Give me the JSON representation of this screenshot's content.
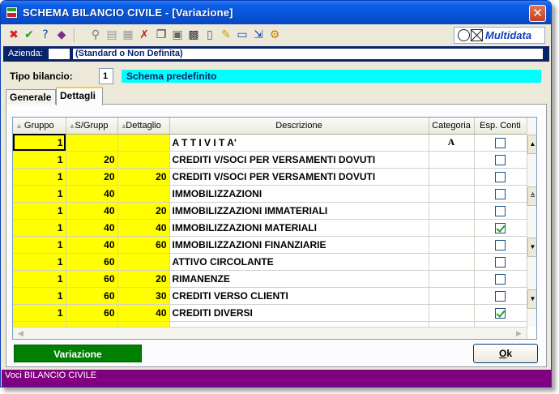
{
  "window": {
    "title": "SCHEMA BILANCIO CIVILE - [Variazione]",
    "close_label": "✕"
  },
  "toolbar": {
    "buttons": [
      {
        "icon": "close-icon",
        "glyph": "✖",
        "color": "#d42020"
      },
      {
        "icon": "check-icon",
        "glyph": "✔",
        "color": "#2a9d2a"
      },
      {
        "icon": "help-icon",
        "glyph": "?",
        "color": "#1340b8"
      },
      {
        "icon": "book-icon",
        "glyph": "◆",
        "color": "#7a2f8a"
      },
      {
        "icon": "binoculars-icon",
        "glyph": "⚲",
        "color": "#777777"
      },
      {
        "icon": "print-preview-icon",
        "glyph": "▤",
        "color": "#999999"
      },
      {
        "icon": "print-icon",
        "glyph": "▦",
        "color": "#999999"
      },
      {
        "icon": "delete-icon",
        "glyph": "✗",
        "color": "#c02020"
      },
      {
        "icon": "copy-icon",
        "glyph": "❐",
        "color": "#333333"
      },
      {
        "icon": "paste-icon",
        "glyph": "▣",
        "color": "#666666"
      },
      {
        "icon": "calculator-icon",
        "glyph": "▩",
        "color": "#333333"
      },
      {
        "icon": "new-document-icon",
        "glyph": "▯",
        "color": "#555555"
      },
      {
        "icon": "edit-document-icon",
        "glyph": "✎",
        "color": "#c8a000"
      },
      {
        "icon": "window-icon",
        "glyph": "▭",
        "color": "#1340b8"
      },
      {
        "icon": "export-icon",
        "glyph": "⇲",
        "color": "#1340b8"
      },
      {
        "icon": "settings-icon",
        "glyph": "⚙",
        "color": "#c88000"
      }
    ],
    "logo_text": "Multidata"
  },
  "azienda": {
    "label": "Azienda:",
    "code": "",
    "name": "(Standard o Non Definita)"
  },
  "tipo_bilancio": {
    "label": "Tipo bilancio:",
    "code": "1",
    "description": "Schema predefinito"
  },
  "tabs": [
    {
      "label": "Generale",
      "active": false
    },
    {
      "label": "Dettagli",
      "active": true
    }
  ],
  "grid": {
    "columns": [
      "Gruppo",
      "S/Grupp",
      "Dettaglio",
      "Descrizione",
      "Categoria",
      "Esp. Conti"
    ],
    "rows": [
      {
        "gruppo": "1",
        "sgrupp": "",
        "dettaglio": "",
        "descrizione": "A T T I V I T A'",
        "categoria": "A",
        "esp_conti": false
      },
      {
        "gruppo": "1",
        "sgrupp": "20",
        "dettaglio": "",
        "descrizione": "CREDITI V/SOCI PER VERSAMENTI DOVUTI",
        "categoria": "",
        "esp_conti": false
      },
      {
        "gruppo": "1",
        "sgrupp": "20",
        "dettaglio": "20",
        "descrizione": "CREDITI V/SOCI PER VERSAMENTI DOVUTI",
        "categoria": "",
        "esp_conti": false
      },
      {
        "gruppo": "1",
        "sgrupp": "40",
        "dettaglio": "",
        "descrizione": "IMMOBILIZZAZIONI",
        "categoria": "",
        "esp_conti": false
      },
      {
        "gruppo": "1",
        "sgrupp": "40",
        "dettaglio": "20",
        "descrizione": "IMMOBILIZZAZIONI IMMATERIALI",
        "categoria": "",
        "esp_conti": false
      },
      {
        "gruppo": "1",
        "sgrupp": "40",
        "dettaglio": "40",
        "descrizione": "IMMOBILIZZAZIONI MATERIALI",
        "categoria": "",
        "esp_conti": true
      },
      {
        "gruppo": "1",
        "sgrupp": "40",
        "dettaglio": "60",
        "descrizione": "IMMOBILIZZAZIONI FINANZIARIE",
        "categoria": "",
        "esp_conti": false
      },
      {
        "gruppo": "1",
        "sgrupp": "60",
        "dettaglio": "",
        "descrizione": "ATTIVO CIRCOLANTE",
        "categoria": "",
        "esp_conti": false
      },
      {
        "gruppo": "1",
        "sgrupp": "60",
        "dettaglio": "20",
        "descrizione": "RIMANENZE",
        "categoria": "",
        "esp_conti": false
      },
      {
        "gruppo": "1",
        "sgrupp": "60",
        "dettaglio": "30",
        "descrizione": "CREDITI VERSO CLIENTI",
        "categoria": "",
        "esp_conti": false
      },
      {
        "gruppo": "1",
        "sgrupp": "60",
        "dettaglio": "40",
        "descrizione": "CREDITI DIVERSI",
        "categoria": "",
        "esp_conti": true
      }
    ]
  },
  "status_mode": "Variazione",
  "ok_button": {
    "underlined": "O",
    "rest": "k"
  },
  "statusbar_text": "Voci BILANCIO CIVILE",
  "colors": {
    "key_columns": "#ffff00",
    "mode_indicator": "#008000",
    "statusbar": "#800080",
    "tipo_description_bg": "#00ffff"
  }
}
